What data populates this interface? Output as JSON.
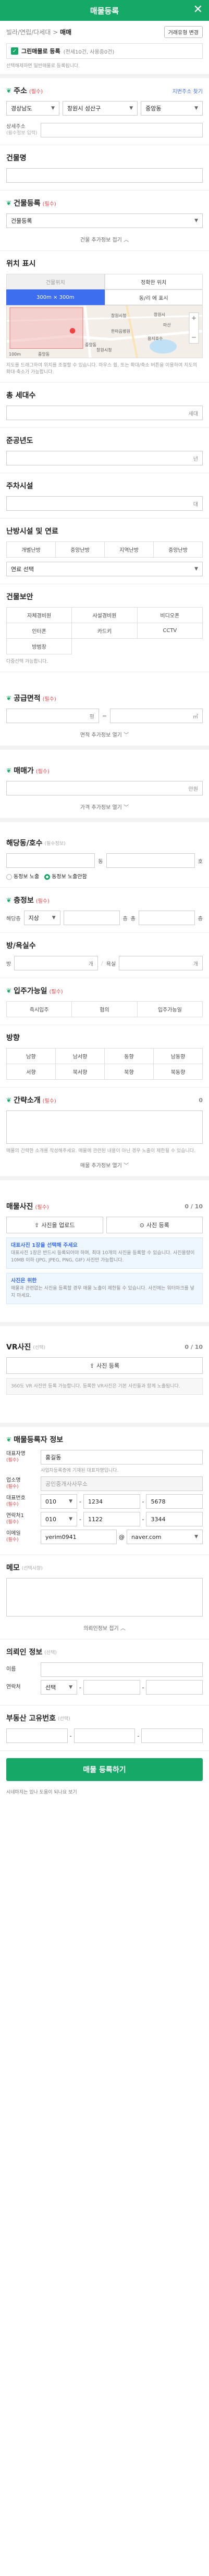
{
  "header": {
    "title": "매물등록",
    "close": "✕"
  },
  "top": {
    "breadcrumb_prefix": "빌라/연립/다세대",
    "breadcrumb_type": "매매",
    "change_type_button": "거래유형 변경",
    "check_label": "그린매물로 등록",
    "check_note": "(전세10건, 사용중0건)",
    "note": "선택해제하면 일반매물로 등록됩니다."
  },
  "address": {
    "title": "주소",
    "req": "(필수)",
    "toggle_link": "지번주소 찾기",
    "sel1": "경상남도",
    "sel2": "창원시 성산구",
    "sel3": "중앙동",
    "detail_label": "상세주소",
    "detail_opt": "(필수정보 입력)",
    "detail_value": ""
  },
  "building_name": {
    "title": "건물명",
    "value": ""
  },
  "building_reg": {
    "title": "건물등록",
    "req": "(필수)",
    "select": "건물등록"
  },
  "more1": "건물 추가정보 접기",
  "location": {
    "title": "위치 표시",
    "tab1": "건물위치",
    "tab2": "정확한 위치",
    "tab3": "300m × 300m",
    "tab4": "동/리 에 표시",
    "map_labels": [
      "중앙동",
      "창원시청",
      "용지호수",
      "한마음병원",
      "중앙동",
      "창원시",
      "창원시청",
      "마산"
    ],
    "scale": "100m",
    "note": "지도를 드래그하여 위치를 조절할 수 있습니다. 마우스 휠, 또는 확대/축소 버튼을 이용하여 지도의 확대·축소가 가능합니다."
  },
  "households": {
    "title": "총 세대수",
    "unit": "세대"
  },
  "completion": {
    "title": "준공년도",
    "unit": "년"
  },
  "parking": {
    "title": "주차시설",
    "unit": "대"
  },
  "heating": {
    "title": "난방시설 및 연료",
    "options": [
      "개별난방",
      "중앙난방",
      "지역난방",
      "중앙난방"
    ],
    "select": "연료 선택"
  },
  "security": {
    "title": "건물보안",
    "options": [
      "자체경비원",
      "사설경비원",
      "비디오폰",
      "인터폰",
      "카드키",
      "CCTV",
      "방범창"
    ],
    "note": "다중선택 가능합니다."
  },
  "area": {
    "title": "공급면적",
    "req": "(필수)",
    "unit1": "평",
    "unit2": "㎡",
    "more": "면적 추가정보 열기"
  },
  "price": {
    "title": "매매가",
    "req": "(필수)",
    "unit": "만원",
    "more": "가격 추가정보 열기"
  },
  "room": {
    "title": "해당동/호수",
    "opt": "(필수정보)",
    "dong": "동",
    "ho": "호",
    "radio1": "동정보 노출",
    "radio2": "동정보 노출안함"
  },
  "floor": {
    "title": "층정보",
    "req": "(필수)",
    "label": "해당층",
    "sel": "지상",
    "unit": "층",
    "total_label": "총",
    "total_unit": "층"
  },
  "rooms": {
    "title": "방/욕실수",
    "label1": "방",
    "unit1": "개",
    "label2": "욕실",
    "unit2": "개"
  },
  "movein": {
    "title": "입주가능일",
    "req": "(필수)",
    "options": [
      "즉시입주",
      "협의",
      "입주가능일"
    ]
  },
  "direction": {
    "title": "방향",
    "options": [
      "남향",
      "남서향",
      "동향",
      "남동향",
      "서향",
      "북서향",
      "북향",
      "북동향"
    ]
  },
  "intro": {
    "title": "간략소개",
    "req": "(필수)",
    "count": "0",
    "note": "매물의 간략한 소개를 작성해주세요. 매물에 관련된 내용이 아닌 경우 노출이 제한될 수 있습니다.",
    "more": "매물 추가정보 열기"
  },
  "photos": {
    "title": "매물사진",
    "req": "(필수)",
    "count": "0 / 10",
    "btn1": "사진을 업로드",
    "btn2": "사진 등록",
    "info1_title": "대표사진 1장을 선택해 주세요",
    "info1": "대표사진 1장은 반드시 등록되어야 하며, 최대 10개의 사진을 등록할 수 있습니다. 사진용량이 10MB 이하 (JPG, JPEG, PNG, GIF) 사진만 가능합니다.",
    "info2_title": "사진은 위한",
    "info2": "매물과 관련없는 사진을 등록할 경우 매물 노출이 제한될 수 있습니다. 사진에는 워터마크를 넣지 마세요."
  },
  "vr": {
    "title": "VR사진",
    "opt": "(선택)",
    "count": "0 / 10",
    "btn": "사진 등록",
    "note": "360도 VR 사진만 등록 가능합니다. 등록한 VR사진은 기본 사진들과 함께 노출됩니다."
  },
  "contact": {
    "title": "매물등록자 정보",
    "name_label": "대표자명",
    "name_req": "(필수)",
    "name": "홍길동",
    "name_note": "사업자등록증에 기재된 대표자명입니다.",
    "office_label": "업소명",
    "office_req": "(필수)",
    "office": "공인중개사사무소",
    "tel_label": "대표번호",
    "tel_req": "(필수)",
    "tel1": "010",
    "tel2": "1234",
    "tel3": "5678",
    "mobile_label": "연락처1",
    "mobile_req": "(필수)",
    "m1": "010",
    "m2": "1122",
    "m3": "3344",
    "email_label": "이메일",
    "email_req": "(필수)",
    "email1": "yerim0941",
    "email2": "naver.com"
  },
  "memo": {
    "title": "메모",
    "opt": "(선택사항)",
    "toggle": "의뢰인정보 접기"
  },
  "client": {
    "title": "의뢰인 정보",
    "opt": "(선택)",
    "name_label": "이름",
    "phone_label": "연락처",
    "phone_sel": "선택"
  },
  "realestate": {
    "title": "부동산 고유번호",
    "opt": "(선택)"
  },
  "submit": "매물 등록하기",
  "footer": "시네마지는 있나 도움이 되나요 보기"
}
